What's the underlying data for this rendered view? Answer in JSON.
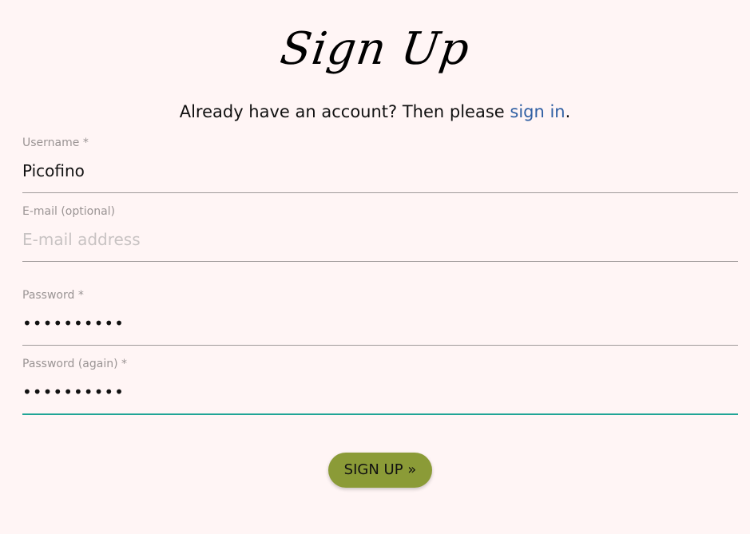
{
  "header": {
    "title": "Sign Up",
    "prompt_text": "Already have an account? Then please ",
    "sign_in_link": "sign in",
    "prompt_end": "."
  },
  "form": {
    "fields": [
      {
        "label": "Username *",
        "value": "Picofino",
        "placeholder": ""
      },
      {
        "label": "E-mail (optional)",
        "value": "",
        "placeholder": "E-mail address"
      },
      {
        "label": "Password *",
        "value": "••••••••••",
        "placeholder": ""
      },
      {
        "label": "Password (again) *",
        "value": "••••••••••",
        "placeholder": ""
      }
    ],
    "submit_label": "SIGN UP »"
  },
  "colors": {
    "background": "#fff5f5",
    "link": "#2f5fa3",
    "button": "#8b9b37",
    "active_line": "#20a596"
  }
}
